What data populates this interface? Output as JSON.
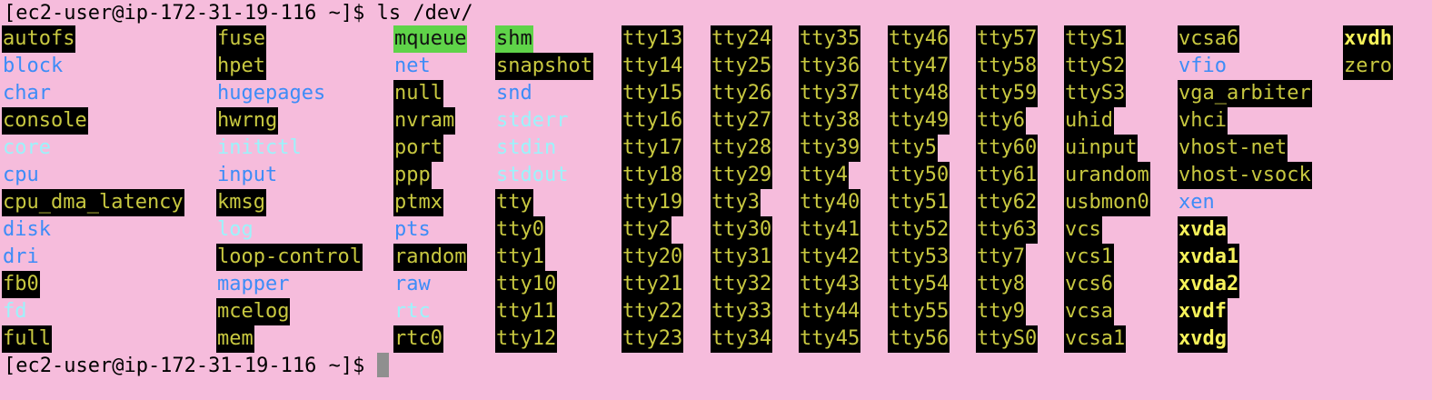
{
  "terminal": {
    "command_line": "[ec2-user@ip-172-31-19-116 ~]$ ls /dev/",
    "prompt_line": "[ec2-user@ip-172-31-19-116 ~]$ ",
    "colors": {
      "background": "#f6bcdc",
      "directory": "#3d8cf7",
      "symlink": "#9cf3fb",
      "char_device": "#c8c840",
      "block_device": "#f6f25a",
      "sticky_dir_bg": "#5fd349",
      "cursor": "#8f8f8f"
    },
    "listing": [
      [
        {
          "name": "autofs",
          "type": "chr"
        },
        {
          "name": "block",
          "type": "dir"
        },
        {
          "name": "char",
          "type": "dir"
        },
        {
          "name": "console",
          "type": "chr"
        },
        {
          "name": "core",
          "type": "link"
        },
        {
          "name": "cpu",
          "type": "dir"
        },
        {
          "name": "cpu_dma_latency",
          "type": "chr"
        },
        {
          "name": "disk",
          "type": "dir"
        },
        {
          "name": "dri",
          "type": "dir"
        },
        {
          "name": "fb0",
          "type": "chr"
        },
        {
          "name": "fd",
          "type": "link"
        },
        {
          "name": "full",
          "type": "chr"
        }
      ],
      [
        {
          "name": "fuse",
          "type": "chr"
        },
        {
          "name": "hpet",
          "type": "chr"
        },
        {
          "name": "hugepages",
          "type": "dir"
        },
        {
          "name": "hwrng",
          "type": "chr"
        },
        {
          "name": "initctl",
          "type": "link"
        },
        {
          "name": "input",
          "type": "dir"
        },
        {
          "name": "kmsg",
          "type": "chr"
        },
        {
          "name": "log",
          "type": "link"
        },
        {
          "name": "loop-control",
          "type": "chr"
        },
        {
          "name": "mapper",
          "type": "dir"
        },
        {
          "name": "mcelog",
          "type": "chr"
        },
        {
          "name": "mem",
          "type": "chr"
        }
      ],
      [
        {
          "name": "mqueue",
          "type": "sticky"
        },
        {
          "name": "net",
          "type": "dir"
        },
        {
          "name": "null",
          "type": "chr"
        },
        {
          "name": "nvram",
          "type": "chr"
        },
        {
          "name": "port",
          "type": "chr"
        },
        {
          "name": "ppp",
          "type": "chr"
        },
        {
          "name": "ptmx",
          "type": "chr"
        },
        {
          "name": "pts",
          "type": "dir"
        },
        {
          "name": "random",
          "type": "chr"
        },
        {
          "name": "raw",
          "type": "dir"
        },
        {
          "name": "rtc",
          "type": "link"
        },
        {
          "name": "rtc0",
          "type": "chr"
        }
      ],
      [
        {
          "name": "shm",
          "type": "sticky"
        },
        {
          "name": "snapshot",
          "type": "chr"
        },
        {
          "name": "snd",
          "type": "dir"
        },
        {
          "name": "stderr",
          "type": "link"
        },
        {
          "name": "stdin",
          "type": "link"
        },
        {
          "name": "stdout",
          "type": "link"
        },
        {
          "name": "tty",
          "type": "chr"
        },
        {
          "name": "tty0",
          "type": "chr"
        },
        {
          "name": "tty1",
          "type": "chr"
        },
        {
          "name": "tty10",
          "type": "chr"
        },
        {
          "name": "tty11",
          "type": "chr"
        },
        {
          "name": "tty12",
          "type": "chr"
        }
      ],
      [
        {
          "name": "tty13",
          "type": "chr"
        },
        {
          "name": "tty14",
          "type": "chr"
        },
        {
          "name": "tty15",
          "type": "chr"
        },
        {
          "name": "tty16",
          "type": "chr"
        },
        {
          "name": "tty17",
          "type": "chr"
        },
        {
          "name": "tty18",
          "type": "chr"
        },
        {
          "name": "tty19",
          "type": "chr"
        },
        {
          "name": "tty2",
          "type": "chr"
        },
        {
          "name": "tty20",
          "type": "chr"
        },
        {
          "name": "tty21",
          "type": "chr"
        },
        {
          "name": "tty22",
          "type": "chr"
        },
        {
          "name": "tty23",
          "type": "chr"
        }
      ],
      [
        {
          "name": "tty24",
          "type": "chr"
        },
        {
          "name": "tty25",
          "type": "chr"
        },
        {
          "name": "tty26",
          "type": "chr"
        },
        {
          "name": "tty27",
          "type": "chr"
        },
        {
          "name": "tty28",
          "type": "chr"
        },
        {
          "name": "tty29",
          "type": "chr"
        },
        {
          "name": "tty3",
          "type": "chr"
        },
        {
          "name": "tty30",
          "type": "chr"
        },
        {
          "name": "tty31",
          "type": "chr"
        },
        {
          "name": "tty32",
          "type": "chr"
        },
        {
          "name": "tty33",
          "type": "chr"
        },
        {
          "name": "tty34",
          "type": "chr"
        }
      ],
      [
        {
          "name": "tty35",
          "type": "chr"
        },
        {
          "name": "tty36",
          "type": "chr"
        },
        {
          "name": "tty37",
          "type": "chr"
        },
        {
          "name": "tty38",
          "type": "chr"
        },
        {
          "name": "tty39",
          "type": "chr"
        },
        {
          "name": "tty4",
          "type": "chr"
        },
        {
          "name": "tty40",
          "type": "chr"
        },
        {
          "name": "tty41",
          "type": "chr"
        },
        {
          "name": "tty42",
          "type": "chr"
        },
        {
          "name": "tty43",
          "type": "chr"
        },
        {
          "name": "tty44",
          "type": "chr"
        },
        {
          "name": "tty45",
          "type": "chr"
        }
      ],
      [
        {
          "name": "tty46",
          "type": "chr"
        },
        {
          "name": "tty47",
          "type": "chr"
        },
        {
          "name": "tty48",
          "type": "chr"
        },
        {
          "name": "tty49",
          "type": "chr"
        },
        {
          "name": "tty5",
          "type": "chr"
        },
        {
          "name": "tty50",
          "type": "chr"
        },
        {
          "name": "tty51",
          "type": "chr"
        },
        {
          "name": "tty52",
          "type": "chr"
        },
        {
          "name": "tty53",
          "type": "chr"
        },
        {
          "name": "tty54",
          "type": "chr"
        },
        {
          "name": "tty55",
          "type": "chr"
        },
        {
          "name": "tty56",
          "type": "chr"
        }
      ],
      [
        {
          "name": "tty57",
          "type": "chr"
        },
        {
          "name": "tty58",
          "type": "chr"
        },
        {
          "name": "tty59",
          "type": "chr"
        },
        {
          "name": "tty6",
          "type": "chr"
        },
        {
          "name": "tty60",
          "type": "chr"
        },
        {
          "name": "tty61",
          "type": "chr"
        },
        {
          "name": "tty62",
          "type": "chr"
        },
        {
          "name": "tty63",
          "type": "chr"
        },
        {
          "name": "tty7",
          "type": "chr"
        },
        {
          "name": "tty8",
          "type": "chr"
        },
        {
          "name": "tty9",
          "type": "chr"
        },
        {
          "name": "ttyS0",
          "type": "chr"
        }
      ],
      [
        {
          "name": "ttyS1",
          "type": "chr"
        },
        {
          "name": "ttyS2",
          "type": "chr"
        },
        {
          "name": "ttyS3",
          "type": "chr"
        },
        {
          "name": "uhid",
          "type": "chr"
        },
        {
          "name": "uinput",
          "type": "chr"
        },
        {
          "name": "urandom",
          "type": "chr"
        },
        {
          "name": "usbmon0",
          "type": "chr"
        },
        {
          "name": "vcs",
          "type": "chr"
        },
        {
          "name": "vcs1",
          "type": "chr"
        },
        {
          "name": "vcs6",
          "type": "chr"
        },
        {
          "name": "vcsa",
          "type": "chr"
        },
        {
          "name": "vcsa1",
          "type": "chr"
        }
      ],
      [
        {
          "name": "vcsa6",
          "type": "chr"
        },
        {
          "name": "vfio",
          "type": "dir"
        },
        {
          "name": "vga_arbiter",
          "type": "chr"
        },
        {
          "name": "vhci",
          "type": "chr"
        },
        {
          "name": "vhost-net",
          "type": "chr"
        },
        {
          "name": "vhost-vsock",
          "type": "chr"
        },
        {
          "name": "xen",
          "type": "dir"
        },
        {
          "name": "xvda",
          "type": "blk"
        },
        {
          "name": "xvda1",
          "type": "blk"
        },
        {
          "name": "xvda2",
          "type": "blk"
        },
        {
          "name": "xvdf",
          "type": "blk"
        },
        {
          "name": "xvdg",
          "type": "blk"
        }
      ],
      [
        {
          "name": "xvdh",
          "type": "blk"
        },
        {
          "name": "zero",
          "type": "chr"
        }
      ]
    ]
  }
}
